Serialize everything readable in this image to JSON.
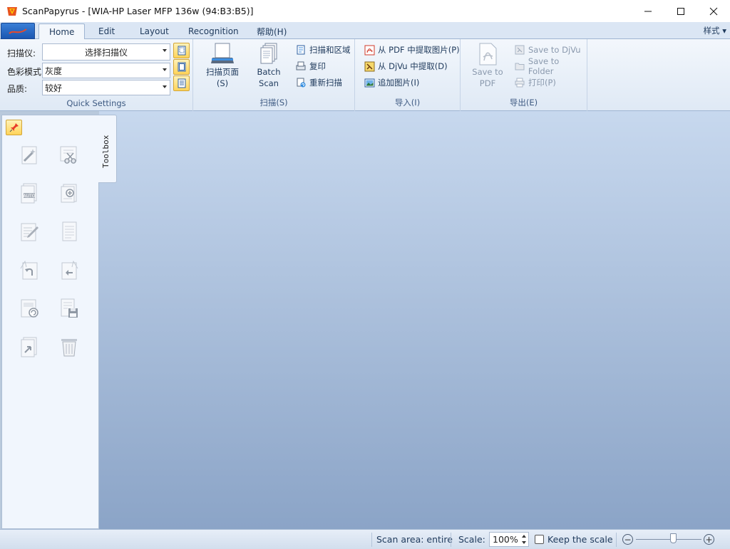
{
  "window": {
    "title": "ScanPapyrus - [WIA-HP Laser MFP 136w (94:B3:B5)]",
    "minimize_glyph": "—",
    "maximize_glyph": "☐",
    "close_glyph": "✕"
  },
  "ribbon_tabs": [
    {
      "label": "Home",
      "active": true
    },
    {
      "label": "Edit"
    },
    {
      "label": "Layout"
    },
    {
      "label": "Recognition"
    },
    {
      "label": "帮助(H)"
    }
  ],
  "style_menu": "样式",
  "quick_settings": {
    "group_label": "Quick Settings",
    "scanner_label": "扫描仪:",
    "scanner_value": "选择扫描仪",
    "color_mode_label": "色彩模式:",
    "color_mode_value": "灰度",
    "quality_label": "品质:",
    "quality_value": "较好"
  },
  "scan_group": {
    "group_label": "扫描(S)",
    "scan_page": "扫描页面(S)",
    "batch_scan_line1": "Batch",
    "batch_scan_line2": "Scan",
    "scan_and_area": "扫描和区域",
    "copy": "复印",
    "rescan": "重新扫描"
  },
  "import_group": {
    "group_label": "导入(I)",
    "extract_pdf": "从 PDF 中提取图片(P)",
    "extract_djvu": "从 DjVu 中提取(D)",
    "add_image": "追加图片(I)"
  },
  "export_group": {
    "group_label": "导出(E)",
    "save_to_pdf_line1": "Save to",
    "save_to_pdf_line2": "PDF",
    "save_to_djvu": "Save to DjVu",
    "save_to_folder": "Save to Folder",
    "print": "打印(P)"
  },
  "toolbox": {
    "tab_label": "Toolbox",
    "tools": [
      "magic-wand-icon",
      "cut-page-icon",
      "auto-icon",
      "add-page-icon",
      "edit-page-icon",
      "blank-page-icon",
      "rotate-left-icon",
      "rotate-right-icon",
      "refresh-page-icon",
      "save-page-icon",
      "move-page-icon",
      "trash-icon"
    ]
  },
  "statusbar": {
    "scan_area": "Scan area: entire",
    "scale_label": "Scale:",
    "scale_value": "100%",
    "keep_scale": "Keep the scale",
    "zoom_out": "−",
    "zoom_in": "+"
  },
  "colors": {
    "ribbon_bg": "#dfe9f5",
    "canvas_top": "#c7d8ee",
    "canvas_bottom": "#8ba4c7",
    "accent_orange": "#ffd45a"
  }
}
